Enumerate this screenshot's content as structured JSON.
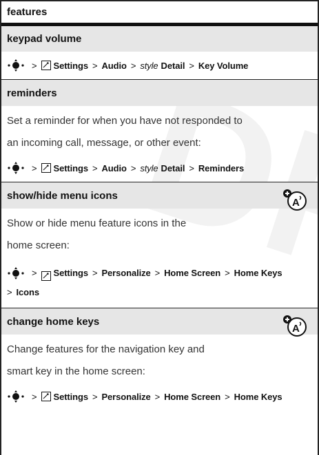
{
  "header": {
    "title": "features"
  },
  "watermark": "DR",
  "sections": [
    {
      "title": "keypad volume",
      "path": [
        "Settings",
        "Audio",
        "style",
        "Detail",
        "Key Volume"
      ]
    },
    {
      "title": "reminders",
      "description_lines": [
        "Set a reminder for when you have not responded to",
        "an incoming call, message, or other event:"
      ],
      "path": [
        "Settings",
        "Audio",
        "style",
        "Detail",
        "Reminders"
      ]
    },
    {
      "title": "show/hide menu icons",
      "description_lines": [
        "Show or hide menu feature icons in the",
        "home screen:"
      ],
      "path": [
        "Settings",
        "Personalize",
        "Home Screen",
        "Home Keys",
        "Icons"
      ]
    },
    {
      "title": "change home keys",
      "description_lines": [
        "Change features for the navigation key and",
        "smart key in the home screen:"
      ],
      "path": [
        "Settings",
        "Personalize",
        "Home Screen",
        "Home Keys"
      ]
    }
  ],
  "sep": ">"
}
